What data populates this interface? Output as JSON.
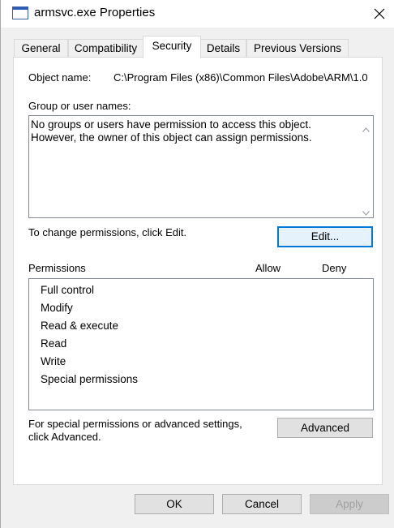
{
  "window": {
    "title": "armsvc.exe Properties"
  },
  "tabs": [
    {
      "label": "General"
    },
    {
      "label": "Compatibility"
    },
    {
      "label": "Security"
    },
    {
      "label": "Details"
    },
    {
      "label": "Previous Versions"
    }
  ],
  "active_tab": "Security",
  "object": {
    "label": "Object name:",
    "value": "C:\\Program Files (x86)\\Common Files\\Adobe\\ARM\\1.0"
  },
  "groups": {
    "label": "Group or user names:",
    "message_line1": "No groups or users have permission to access this object.",
    "message_line2": "However, the owner of this object can assign permissions."
  },
  "change_hint": "To change permissions, click Edit.",
  "edit_button": "Edit...",
  "permissions": {
    "label": "Permissions",
    "allow_label": "Allow",
    "deny_label": "Deny",
    "items": [
      "Full control",
      "Modify",
      "Read & execute",
      "Read",
      "Write",
      "Special permissions"
    ]
  },
  "advanced": {
    "hint_line1": "For special permissions or advanced settings,",
    "hint_line2": "click Advanced.",
    "button": "Advanced"
  },
  "footer": {
    "ok": "OK",
    "cancel": "Cancel",
    "apply": "Apply"
  },
  "colors": {
    "focus_border": "#0078d7",
    "dialog_bg": "#f0f0f0",
    "disabled_text": "#a0a0a0"
  }
}
